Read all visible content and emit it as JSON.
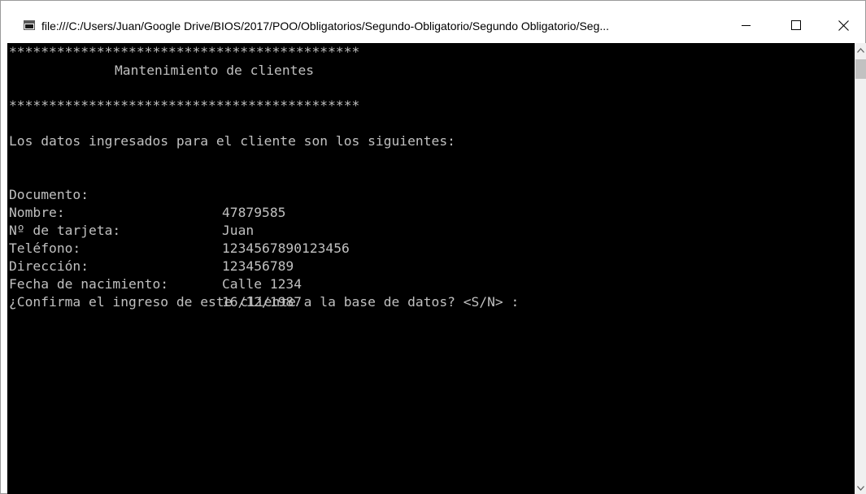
{
  "window": {
    "title": "file:///C:/Users/Juan/Google Drive/BIOS/2017/POO/Obligatorios/Segundo-Obligatorio/Segundo Obligatorio/Seg..."
  },
  "console": {
    "stars_top": "********************************************",
    "heading": "Mantenimiento de clientes",
    "stars_bottom": "********************************************",
    "intro": "Los datos ingresados para el cliente son los siguientes:",
    "fields": [
      {
        "label": "Documento:",
        "value": "47879585"
      },
      {
        "label": "Nombre:",
        "value": "Juan"
      },
      {
        "label": "Nº de tarjeta:",
        "value": "1234567890123456"
      },
      {
        "label": "Teléfono:",
        "value": "123456789"
      },
      {
        "label": "Dirección:",
        "value": "Calle 1234"
      },
      {
        "label": "Fecha de nacimiento:",
        "value": "16/12/1987"
      }
    ],
    "prompt": "¿Confirma el ingreso de este cliente a la base de datos? <S/N> :"
  },
  "colors": {
    "console_bg": "#000000",
    "console_text": "#c0c0c0"
  },
  "icons": [
    "console-app-icon",
    "minimize-icon",
    "maximize-icon",
    "close-icon",
    "scroll-up-arrow-icon",
    "scroll-down-arrow-icon"
  ]
}
